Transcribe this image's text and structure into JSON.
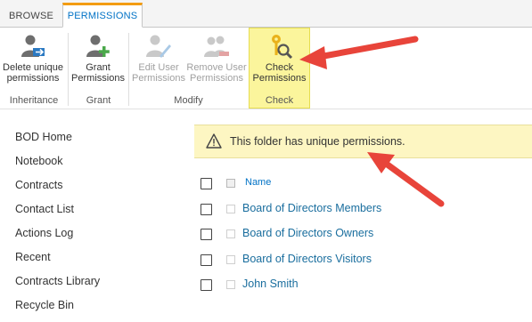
{
  "tabs": {
    "browse": "BROWSE",
    "permissions": "PERMISSIONS"
  },
  "ribbon": {
    "delete_unique": {
      "line1": "Delete unique",
      "line2": "permissions"
    },
    "grant": {
      "line1": "Grant",
      "line2": "Permissions"
    },
    "edit_user": {
      "line1": "Edit User",
      "line2": "Permissions"
    },
    "remove_user": {
      "line1": "Remove User",
      "line2": "Permissions"
    },
    "check": {
      "line1": "Check",
      "line2": "Permissions"
    },
    "groups": {
      "inheritance": "Inheritance",
      "grant": "Grant",
      "modify": "Modify",
      "check": "Check"
    }
  },
  "nav": [
    "BOD Home",
    "Notebook",
    "Contracts",
    "Contact List",
    "Actions Log",
    "Recent",
    "Contracts Library",
    "Recycle Bin"
  ],
  "banner": {
    "text": "This folder has unique permissions."
  },
  "list": {
    "header": "Name",
    "rows": [
      "Board of Directors Members",
      "Board of Directors Owners",
      "Board of Directors Visitors",
      "John Smith"
    ]
  },
  "colors": {
    "accent": "#f39c12",
    "link": "#1a6e9e",
    "highlight": "#fbf59c",
    "arrow": "#e8443a"
  }
}
